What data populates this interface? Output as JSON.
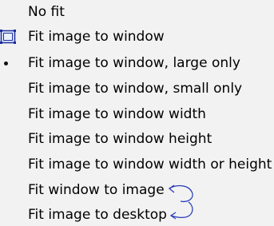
{
  "menu": {
    "items": [
      {
        "label": "No fit",
        "marker": "none"
      },
      {
        "label": "Fit image to window",
        "marker": "fit-window-icon"
      },
      {
        "label": "Fit image to window, large only",
        "marker": "radio-bullet"
      },
      {
        "label": "Fit image to window, small only",
        "marker": "none"
      },
      {
        "label": "Fit image to window width",
        "marker": "none"
      },
      {
        "label": "Fit image to window height",
        "marker": "none"
      },
      {
        "label": "Fit image to window width or height",
        "marker": "none"
      },
      {
        "label": "Fit window to image",
        "marker": "none"
      },
      {
        "label": "Fit image to desktop",
        "marker": "none"
      }
    ],
    "selected_index": 2
  },
  "colors": {
    "menu_background": "#f2f2f2",
    "text": "#000000",
    "icon_blue": "#1f2f9a",
    "annotation_arrow": "#2a3db8"
  }
}
